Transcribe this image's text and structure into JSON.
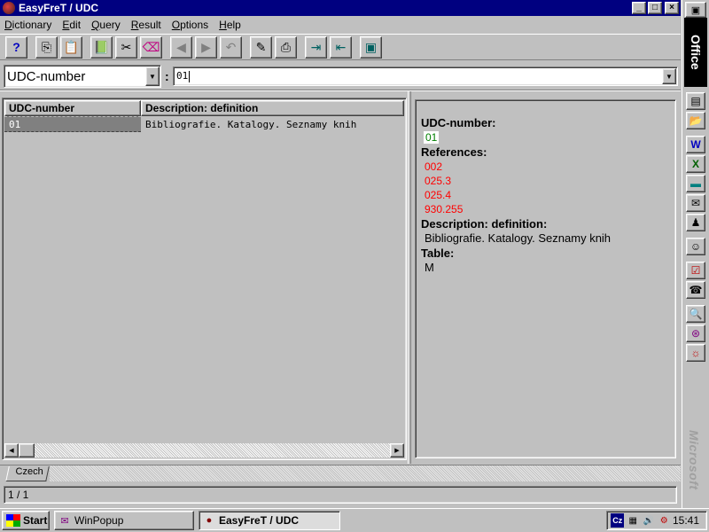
{
  "window": {
    "title": "EasyFreT / UDC",
    "min": "_",
    "max": "□",
    "close": "×"
  },
  "menu": [
    {
      "key": "D",
      "rest": "ictionary"
    },
    {
      "key": "E",
      "rest": "dit"
    },
    {
      "key": "Q",
      "rest": "uery"
    },
    {
      "key": "R",
      "rest": "esult"
    },
    {
      "key": "O",
      "rest": "ptions"
    },
    {
      "key": "H",
      "rest": "elp"
    }
  ],
  "toolbar": {
    "icons": [
      "?",
      "⎘",
      "📋",
      "📗",
      "✂",
      "⌫",
      "◀",
      "▶",
      "↶",
      "✎",
      "⎙",
      "⇥",
      "⇤",
      "▣"
    ]
  },
  "query": {
    "field": "UDC-number",
    "separator": ":",
    "input_value": "01",
    "dropdown_glyph": "▼"
  },
  "grid": {
    "columns": [
      "UDC-number",
      "Description: definition"
    ],
    "rows": [
      {
        "udc": "01",
        "description": "Bibliografie. Katalogy. Seznamy knih"
      }
    ],
    "scroll_left": "◀",
    "scroll_right": "▶"
  },
  "detail": {
    "udc_label": "UDC-number:",
    "udc_value": "01",
    "references_label": "References:",
    "references": [
      "002",
      "025.3",
      "025.4",
      "930.255"
    ],
    "description_label": "Description: definition:",
    "description_value": "Bibliografie. Katalogy. Seznamy knih",
    "table_label": "Table:",
    "table_value": "M"
  },
  "tabs": [
    "Czech"
  ],
  "status": {
    "text": "1 / 1"
  },
  "officebar": {
    "logo": "Office",
    "brand": "Microsoft",
    "top_icon": "▣",
    "icons": [
      "▤",
      "📂",
      "W",
      "X",
      "▬",
      "✉",
      "♟",
      "☺",
      "☑",
      "☎",
      "🔍",
      "⊛",
      "☼"
    ]
  },
  "taskbar": {
    "start": "Start",
    "tasks": [
      "WinPopup",
      "EasyFreT / UDC"
    ],
    "lang": "Cz",
    "tray_icons": [
      "▦",
      "🔊",
      "⚙"
    ],
    "clock": "15:41"
  }
}
